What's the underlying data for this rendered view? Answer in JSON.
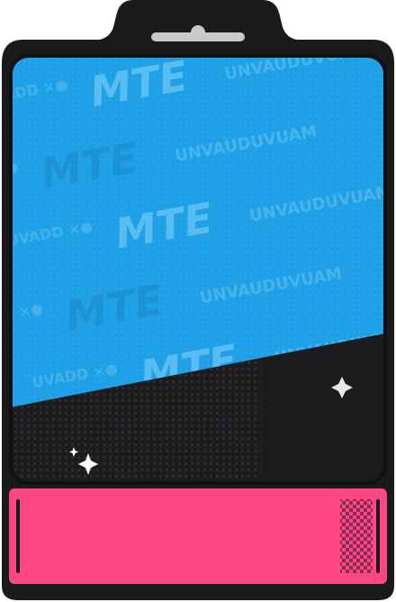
{
  "card": {
    "frame_color": "#1a1a1c",
    "tab_slot_color": "#c9c9cb",
    "banner_color": "#1fa0e6",
    "panel_color": "#1c1c1e",
    "footer_color": "#ff4785",
    "footer_accent_color": "#8a2d52",
    "watermark_color": "#63c2f2",
    "watermark_rows": [
      {
        "left": "MTE",
        "right": "UNVAUDUVUAM"
      },
      {
        "left": "MTE",
        "right": "UNVAUDUVUAM"
      },
      {
        "left": "MTE",
        "right": "UNVAUDUVUAM"
      },
      {
        "left": "MTE",
        "right": "UNVAUDUVUAM"
      },
      {
        "left": "MTE",
        "right": "UNVAUDUVUAM"
      }
    ],
    "icons": [
      "sparkle-icon",
      "sparkle-icon",
      "sparkle-icon",
      "checker-pattern-icon"
    ]
  }
}
